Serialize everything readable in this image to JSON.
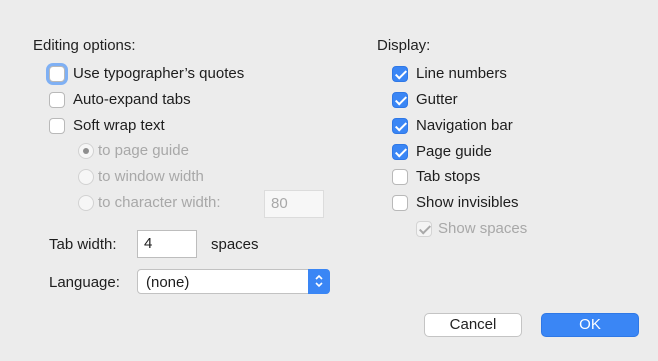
{
  "editing": {
    "heading": "Editing options:",
    "use_quotes": "Use typographer’s quotes",
    "auto_expand": "Auto-expand tabs",
    "soft_wrap": "Soft wrap text",
    "wrap_options": {
      "page_guide": "to page guide",
      "window_width": "to window width",
      "char_width": "to character width:",
      "char_width_value": "80"
    },
    "tab_width_label": "Tab width:",
    "tab_width_value": "4",
    "tab_width_units": "spaces",
    "language_label": "Language:",
    "language_value": "(none)"
  },
  "display": {
    "heading": "Display:",
    "line_numbers": "Line numbers",
    "gutter": "Gutter",
    "navigation_bar": "Navigation bar",
    "page_guide": "Page guide",
    "tab_stops": "Tab stops",
    "show_invisibles": "Show invisibles",
    "show_spaces": "Show spaces"
  },
  "buttons": {
    "cancel": "Cancel",
    "ok": "OK"
  },
  "colors": {
    "accent": "#3a86f5",
    "background": "#ececec",
    "disabled_text": "#a8a8a8"
  }
}
